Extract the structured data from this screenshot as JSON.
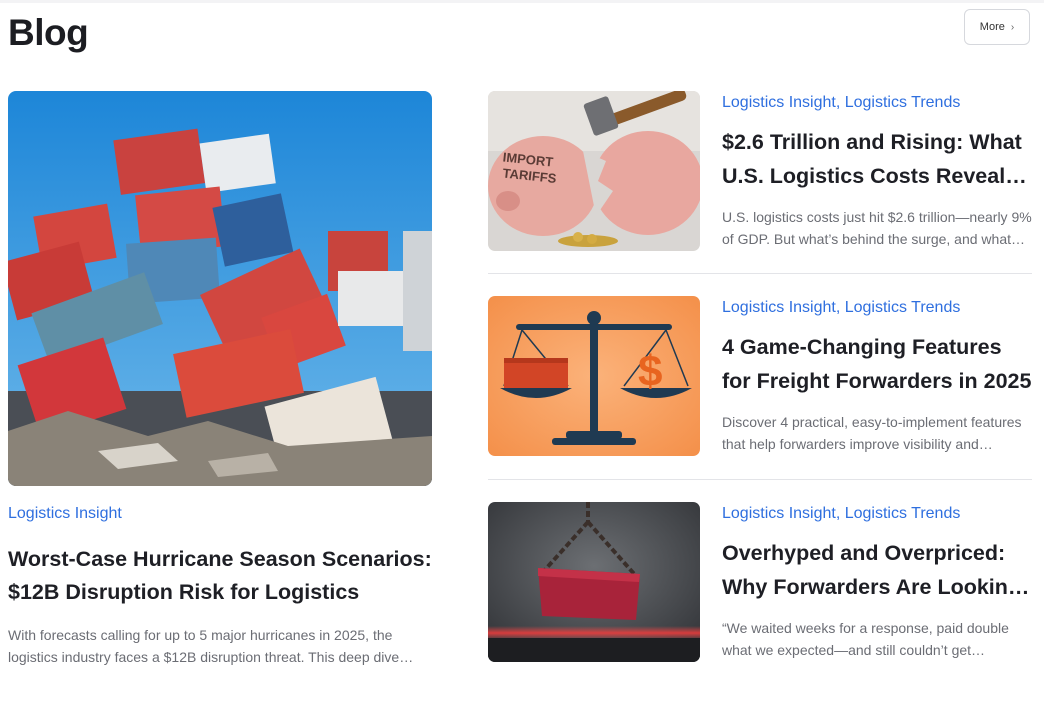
{
  "header": {
    "title": "Blog",
    "more_label": "More"
  },
  "featured": {
    "category": "Logistics Insight",
    "title": "Worst-Case Hurricane Season Scenarios: $12B Disruption Risk for Logistics",
    "excerpt": "With forecasts calling for up to 5 major hurricanes in 2025, the logistics industry faces a $12B disruption threat. This deep dive explores worst-case scenarios."
  },
  "posts": [
    {
      "category": "Logistics Insight, Logistics Trends",
      "title": "$2.6 Trillion and Rising: What U.S. Logistics Costs Reveal About the Industry",
      "excerpt": "U.S. logistics costs just hit $2.6 trillion—nearly 9% of GDP. But what’s behind the surge, and what does it mean for forwarders?",
      "image_text": "IMPORT TARIFFS"
    },
    {
      "category": "Logistics Insight, Logistics Trends",
      "title": "4 Game-Changing Features for Freight Forwarders in 2025",
      "excerpt": "Discover 4 practical, easy-to-implement features that help forwarders improve visibility and margins.",
      "image_text": "$"
    },
    {
      "category": "Logistics Insight, Logistics Trends",
      "title": "Overhyped and Overpriced: Why Forwarders Are Looking for Alternatives",
      "excerpt": "“We waited weeks for a response, paid double what we expected—and still couldn’t get answers.”"
    }
  ],
  "colors": {
    "accent": "#2f6fdf",
    "text": "#1e1f25",
    "muted": "#6b6d74",
    "divider": "#e3e4e8"
  },
  "icons": {
    "more": "chevron-right-icon"
  }
}
